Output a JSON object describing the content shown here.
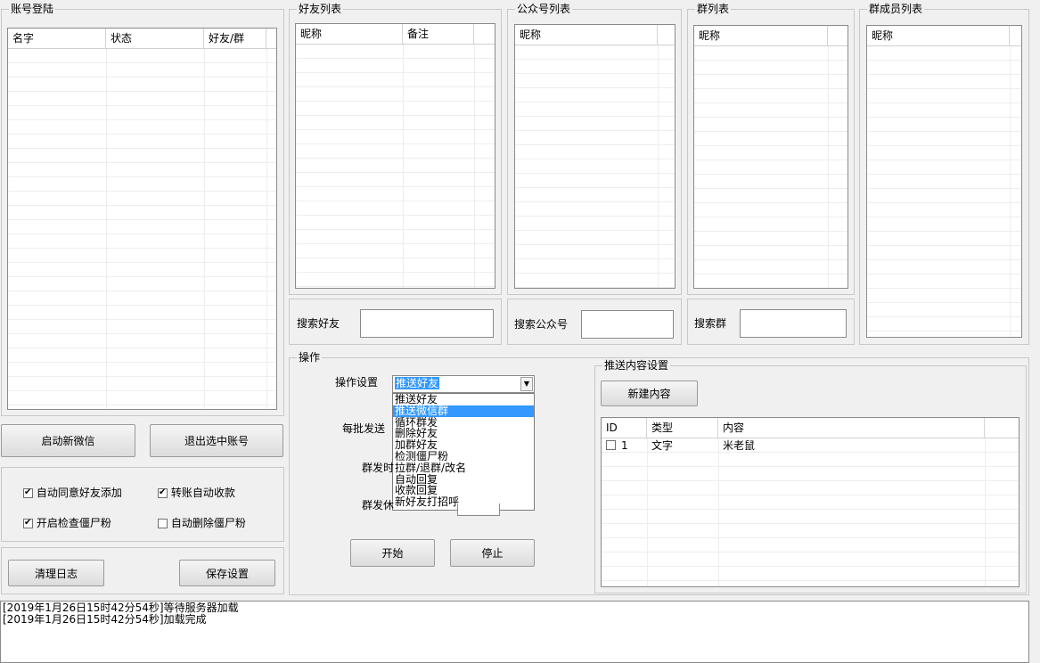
{
  "account_panel": {
    "title": "账号登陆",
    "columns": [
      "名字",
      "状态",
      "好友/群"
    ],
    "start_button": "启动新微信",
    "logout_button": "退出选中账号"
  },
  "options": {
    "auto_accept_friend": {
      "label": "自动同意好友添加",
      "checked": true
    },
    "auto_collect_transfer": {
      "label": "转账自动收款",
      "checked": true
    },
    "check_zombie": {
      "label": "开启检查僵尸粉",
      "checked": true
    },
    "auto_delete_zombie": {
      "label": "自动删除僵尸粉",
      "checked": false
    }
  },
  "clear_log_button": "清理日志",
  "save_settings_button": "保存设置",
  "friends_panel": {
    "title": "好友列表",
    "columns": [
      "昵称",
      "备注"
    ],
    "search_label": "搜索好友"
  },
  "public_panel": {
    "title": "公众号列表",
    "columns": [
      "昵称"
    ],
    "search_label": "搜索公众号"
  },
  "groups_panel": {
    "title": "群列表",
    "columns": [
      "昵称"
    ],
    "search_label": "搜索群"
  },
  "members_panel": {
    "title": "群成员列表",
    "columns": [
      "昵称"
    ]
  },
  "operation": {
    "title": "操作",
    "setting_label": "操作设置",
    "selected_value": "推送好友",
    "dropdown_options": [
      "推送好友",
      "推送微信群",
      "循环群发",
      "删除好友",
      "加群好友",
      "检测僵尸粉",
      "拉群/退群/改名",
      "自动回复",
      "收款回复",
      "新好友打招呼"
    ],
    "highlighted_index": 1,
    "batch_label": "每批发送",
    "group_time_label": "群发时",
    "group_rest_label": "群发休",
    "start_button": "开始",
    "stop_button": "停止"
  },
  "push_panel": {
    "title": "推送内容设置",
    "new_button": "新建内容",
    "columns": [
      "ID",
      "类型",
      "内容"
    ],
    "rows": [
      {
        "id": "1",
        "type": "文字",
        "content": "米老鼠"
      }
    ]
  },
  "log": {
    "lines": [
      "[2019年1月26日15时42分54秒]等待服务器加载",
      "[2019年1月26日15时42分54秒]加载完成"
    ]
  }
}
